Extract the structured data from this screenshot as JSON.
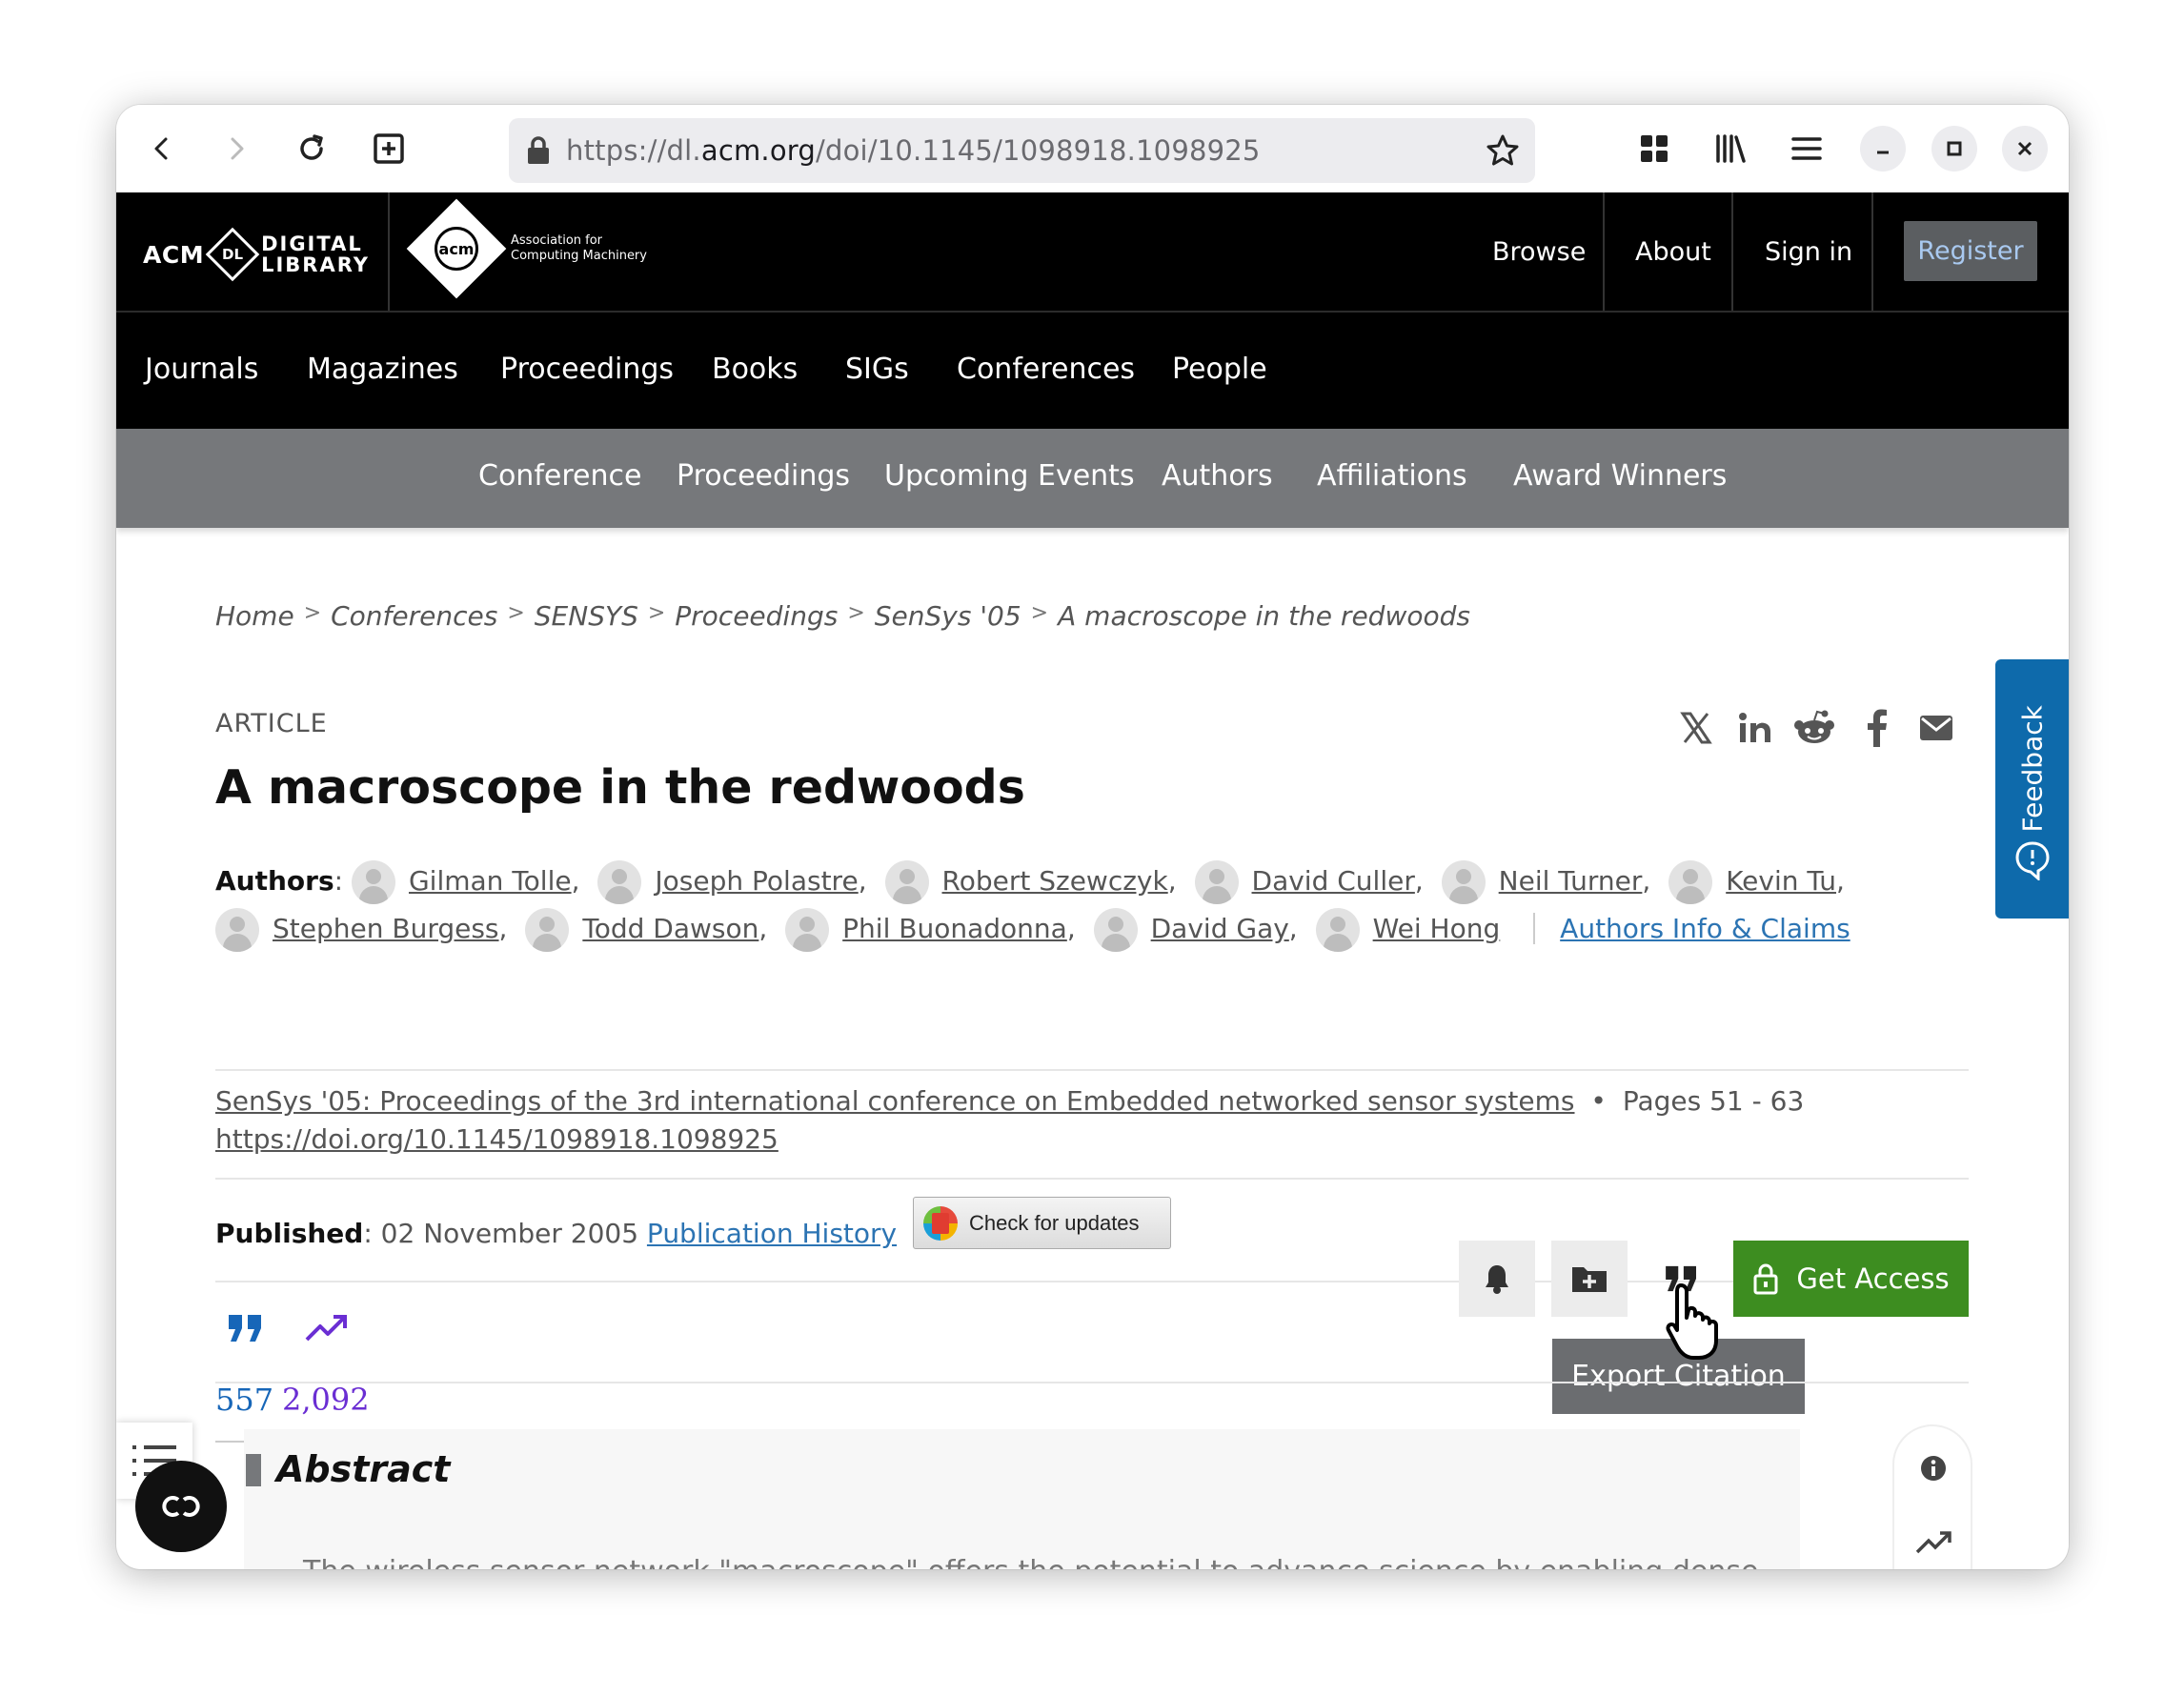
{
  "browser": {
    "url_prefix": "https://dl.",
    "url_domain": "acm.org",
    "url_path": "/doi/10.1145/1098918.1098925"
  },
  "site_header": {
    "dl_logo_acm": "ACM",
    "dl_logo_mark": "DL",
    "dl_logo_line1": "DIGITAL",
    "dl_logo_line2": "LIBRARY",
    "acm_logo_mark": "acm",
    "acm_logo_line1": "Association for",
    "acm_logo_line2": "Computing Machinery",
    "browse": "Browse",
    "about": "About",
    "sign_in": "Sign in",
    "register": "Register"
  },
  "main_nav": [
    "Journals",
    "Magazines",
    "Proceedings",
    "Books",
    "SIGs",
    "Conferences",
    "People"
  ],
  "sub_nav": [
    "Conference",
    "Proceedings",
    "Upcoming Events",
    "Authors",
    "Affiliations",
    "Award Winners"
  ],
  "breadcrumb": [
    "Home",
    "Conferences",
    "SENSYS",
    "Proceedings",
    "SenSys '05",
    "A macroscope in the redwoods"
  ],
  "article": {
    "type": "ARTICLE",
    "title": "A macroscope in the redwoods",
    "authors_label": "Authors",
    "authors": [
      "Gilman Tolle",
      "Joseph Polastre",
      "Robert Szewczyk",
      "David Culler",
      "Neil Turner",
      "Kevin Tu",
      "Stephen Burgess",
      "Todd Dawson",
      "Phil Buonadonna",
      "David Gay",
      "Wei Hong"
    ],
    "authors_claims": "Authors Info & Claims",
    "proceedings": "SenSys '05: Proceedings of the 3rd international conference on Embedded networked sensor systems",
    "pages": "Pages 51 - 63",
    "doi": "https://doi.org/10.1145/1098918.1098925",
    "published_label": "Published",
    "published_date": ": 02 November 2005 ",
    "publication_history": "Publication History",
    "check_for_updates": "Check for updates",
    "citations": "557",
    "downloads": "2,092",
    "get_access": "Get Access",
    "tooltip": "Export Citation",
    "abstract_title": "Abstract",
    "abstract_text": "The wireless sensor network \"macroscope\" offers the potential to advance science by enabling dense"
  },
  "feedback": "Feedback",
  "colors": {
    "accent_blue": "#0e6aab",
    "get_access_green": "#3d8d20",
    "citation_blue": "#1766b8",
    "downloads_purple": "#6a2ed3"
  }
}
